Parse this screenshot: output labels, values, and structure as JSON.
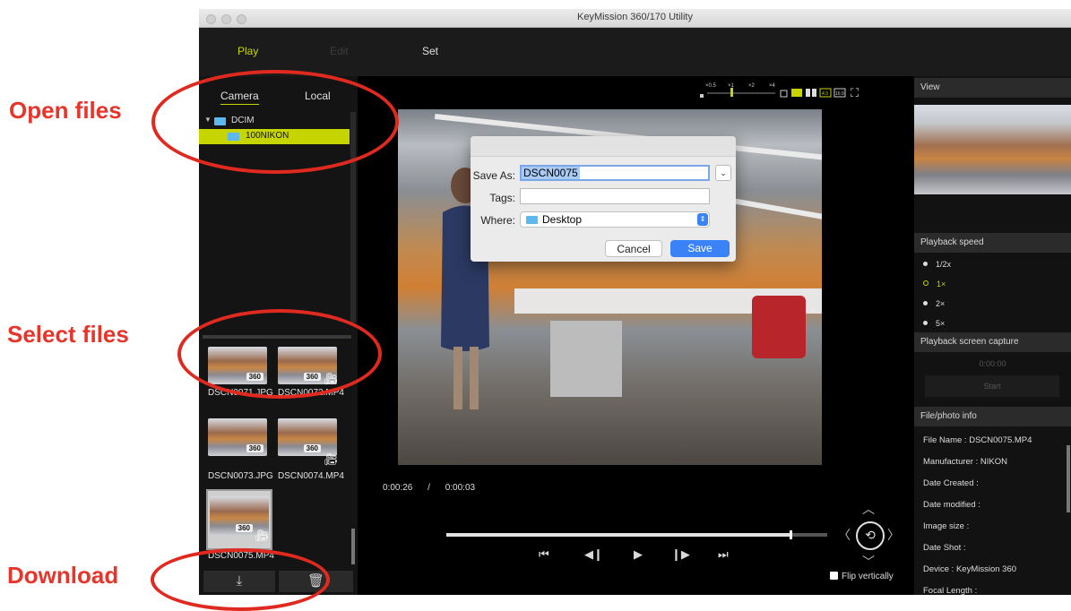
{
  "annotations": {
    "open_files": "Open files",
    "select_files": "Select files",
    "download": "Download"
  },
  "window": {
    "title": "KeyMission 360/170 Utility"
  },
  "nav": {
    "play": "Play",
    "edit": "Edit",
    "set": "Set"
  },
  "browser": {
    "tab_camera": "Camera",
    "tab_local": "Local",
    "tree": [
      {
        "label": "DCIM"
      },
      {
        "label": "100NIKON",
        "selected": true
      }
    ],
    "thumbs": [
      {
        "label": "DSCN0071.JPG",
        "badge": "360"
      },
      {
        "label": "DSCN0072.MP4",
        "badge": "360"
      },
      {
        "label": "DSCN0073.JPG",
        "badge": "360"
      },
      {
        "label": "DSCN0074.MP4",
        "badge": "360"
      },
      {
        "label": "DSCN0075.MP4",
        "badge": "360",
        "selected": true
      }
    ]
  },
  "player": {
    "speed_marks": [
      "×0.5",
      "×1",
      "×2",
      "×4"
    ],
    "ratio_43": "4:3",
    "ratio_169": "16:9",
    "time_current": "0:00:26",
    "time_separator": "/",
    "time_total": "0:00:03",
    "progress": 0.9,
    "flip_label": "Flip vertically"
  },
  "dialog": {
    "save_as_label": "Save As:",
    "save_as_value": "DSCN0075",
    "tags_label": "Tags:",
    "tags_value": "",
    "where_label": "Where:",
    "where_value": "Desktop",
    "cancel": "Cancel",
    "save": "Save"
  },
  "right": {
    "view_header": "View",
    "speed_header": "Playback speed",
    "speeds": [
      {
        "label": "1/2x"
      },
      {
        "label": "1×",
        "selected": true
      },
      {
        "label": "2×"
      },
      {
        "label": "5×"
      }
    ],
    "capture_header": "Playback screen capture",
    "capture_time": "0:00:00",
    "capture_start": "Start",
    "info_header": "File/photo info",
    "info_lines": [
      "File Name : DSCN0075.MP4",
      "Manufacturer : NIKON",
      "Date Created :",
      "Date modified :",
      "Image size :",
      "Date Shot :",
      "Device : KeyMission 360",
      "Focal Length :"
    ]
  },
  "colors": {
    "accent": "#c8d400",
    "annotation_red": "#e8352b",
    "save_blue": "#3a82f7"
  }
}
